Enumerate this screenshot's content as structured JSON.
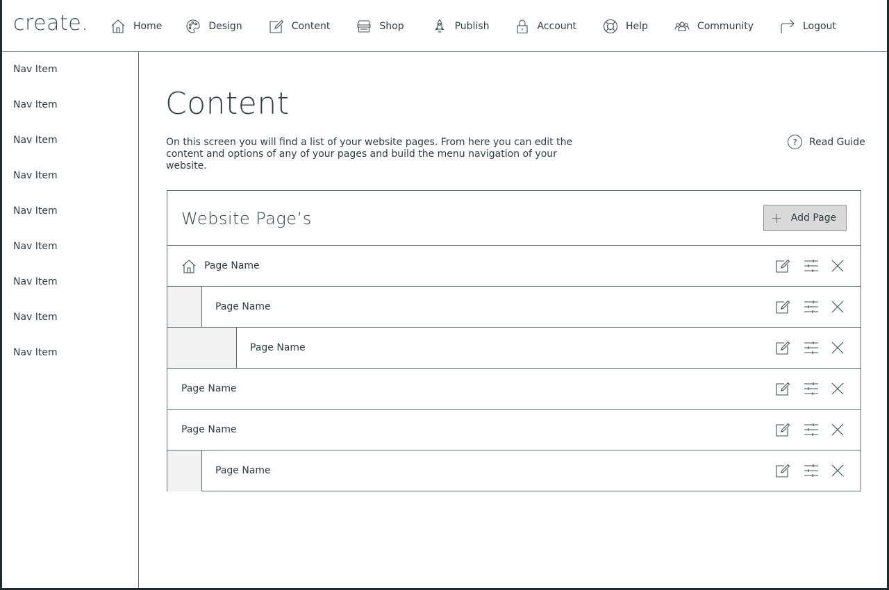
{
  "app": {
    "logo": "create",
    "logo_dot": "."
  },
  "topnav": [
    {
      "label": "Home",
      "icon": "home-icon"
    },
    {
      "label": "Design",
      "icon": "palette-icon"
    },
    {
      "label": "Content",
      "icon": "edit-icon"
    },
    {
      "label": "Shop",
      "icon": "store-icon"
    },
    {
      "label": "Publish",
      "icon": "rocket-icon"
    },
    {
      "label": "Account",
      "icon": "lock-icon"
    },
    {
      "label": "Help",
      "icon": "lifebuoy-icon"
    },
    {
      "label": "Community",
      "icon": "people-icon"
    },
    {
      "label": "Logout",
      "icon": "logout-arrow-icon"
    }
  ],
  "sidebar": {
    "items": [
      {
        "label": "Nav Item"
      },
      {
        "label": "Nav Item"
      },
      {
        "label": "Nav Item"
      },
      {
        "label": "Nav Item"
      },
      {
        "label": "Nav Item"
      },
      {
        "label": "Nav Item"
      },
      {
        "label": "Nav Item"
      },
      {
        "label": "Nav Item"
      },
      {
        "label": "Nav Item"
      }
    ]
  },
  "main": {
    "title": "Content",
    "intro": "On this screen you will find a list of your website pages. From here you can edit the content and options of any of your pages and build the menu navigation of your website.",
    "guide_label": "Read Guide",
    "guide_icon_text": "?"
  },
  "panel": {
    "title": "Website Page’s",
    "add_button": "Add Page",
    "add_icon_text": "+",
    "pages": [
      {
        "name": "Page Name",
        "level": 0,
        "home": true
      },
      {
        "name": "Page Name",
        "level": 1,
        "home": false
      },
      {
        "name": "Page Name",
        "level": 2,
        "home": false
      },
      {
        "name": "Page Name",
        "level": 0,
        "home": false
      },
      {
        "name": "Page Name",
        "level": 0,
        "home": false
      },
      {
        "name": "Page Name",
        "level": 1,
        "home": false
      }
    ]
  },
  "colors": {
    "ink": "#2d3e44",
    "border": "#5f6b6f",
    "indent_fill": "#f2f2f2",
    "button_fill": "#d9d9d9",
    "outer_frame": "#1e2b30"
  }
}
